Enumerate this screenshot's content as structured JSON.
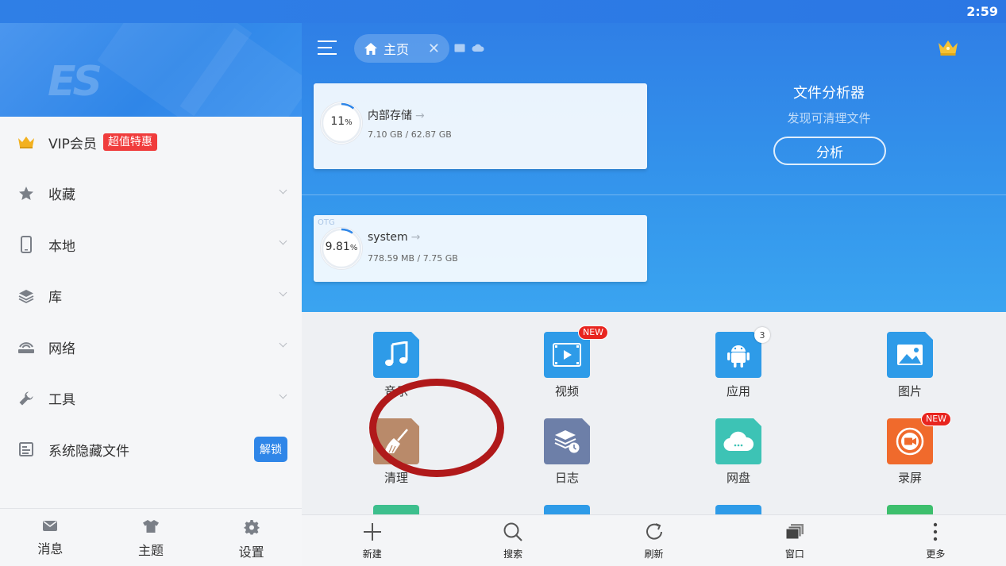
{
  "status": {
    "time": "2:59"
  },
  "drawer": {
    "vip": {
      "label": "VIP会员",
      "badge": "超值特惠"
    },
    "items": [
      {
        "label": "收藏",
        "icon": "star-icon"
      },
      {
        "label": "本地",
        "icon": "phone-icon"
      },
      {
        "label": "库",
        "icon": "layers-icon"
      },
      {
        "label": "网络",
        "icon": "network-icon"
      },
      {
        "label": "工具",
        "icon": "wrench-icon"
      }
    ],
    "hidden_files": {
      "label": "系统隐藏文件",
      "button": "解锁"
    },
    "bottom": [
      {
        "label": "消息",
        "icon": "message-icon"
      },
      {
        "label": "主题",
        "icon": "shirt-icon"
      },
      {
        "label": "设置",
        "icon": "gear-icon"
      }
    ]
  },
  "header": {
    "tab_label": "主页"
  },
  "storage": [
    {
      "name": "内部存储",
      "percent": "11",
      "percent_unit": "%",
      "usage": "7.10 GB / 62.87 GB",
      "fraction": 0.11
    },
    {
      "name": "system",
      "percent": "9.81",
      "percent_unit": "%",
      "usage": "778.59 MB / 7.75 GB",
      "tag": "OTG",
      "fraction": 0.0981
    }
  ],
  "analyzer": {
    "title": "文件分析器",
    "subtitle": "发现可清理文件",
    "button": "分析"
  },
  "apps": [
    {
      "label": "音乐",
      "icon": "music-icon",
      "color": "#2e9be8"
    },
    {
      "label": "视频",
      "icon": "video-icon",
      "color": "#2e9be8",
      "badge": "NEW"
    },
    {
      "label": "应用",
      "icon": "android-icon",
      "color": "#2e9be8",
      "count": "3"
    },
    {
      "label": "图片",
      "icon": "image-icon",
      "color": "#2e9be8"
    },
    {
      "label": "清理",
      "icon": "broom-icon",
      "color": "#b98a6a"
    },
    {
      "label": "日志",
      "icon": "log-icon",
      "color": "#6d7fa8"
    },
    {
      "label": "网盘",
      "icon": "cloud-icon",
      "color": "#3dc3b5"
    },
    {
      "label": "录屏",
      "icon": "record-icon",
      "color": "#f06a2c",
      "badge": "NEW"
    }
  ],
  "toolbar": [
    {
      "label": "新建",
      "icon": "plus-icon"
    },
    {
      "label": "搜索",
      "icon": "search-icon"
    },
    {
      "label": "刷新",
      "icon": "refresh-icon"
    },
    {
      "label": "窗口",
      "icon": "windows-icon"
    },
    {
      "label": "更多",
      "icon": "more-icon"
    }
  ]
}
